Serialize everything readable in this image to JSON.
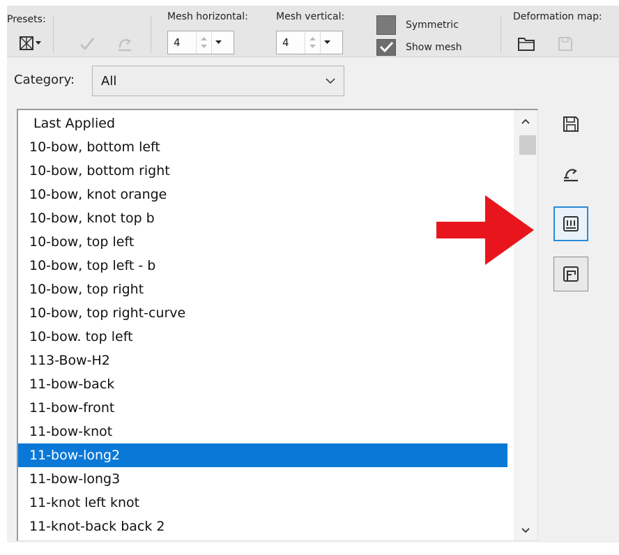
{
  "toolbar": {
    "presets_label": "Presets:",
    "mesh_h_label": "Mesh horizontal:",
    "mesh_h_value": "4",
    "mesh_v_label": "Mesh vertical:",
    "mesh_v_value": "4",
    "symmetric_label": "Symmetric",
    "symmetric_checked": false,
    "show_mesh_label": "Show mesh",
    "show_mesh_checked": true,
    "deformation_label": "Deformation map:"
  },
  "category": {
    "label": "Category:",
    "selected": "All"
  },
  "list": {
    "items": [
      "Last Applied",
      "10-bow, bottom left",
      "10-bow, bottom right",
      "10-bow, knot orange",
      "10-bow, knot top b",
      "10-bow, top left",
      "10-bow, top left - b",
      "10-bow, top right",
      "10-bow, top right-curve",
      "10-bow. top left",
      "113-Bow-H2",
      "11-bow-back",
      "11-bow-front",
      "11-bow-knot",
      "11-bow-long2",
      "11-bow-long3",
      "11-knot left knot",
      "11-knot-back back 2"
    ],
    "selected_index": 14
  },
  "colors": {
    "selection": "#0a78d7",
    "arrow": "#e8161c",
    "active_border": "#2a8ad8"
  },
  "icons": {
    "preset": "preset-grid-icon",
    "apply": "checkmark-icon",
    "reset": "reset-icon",
    "open_map": "folder-icon",
    "save_map": "save-icon",
    "side_save": "save-icon",
    "side_reset": "reset-icon",
    "side_mesh": "mesh-grid-icon",
    "side_frame": "frame-icon"
  }
}
